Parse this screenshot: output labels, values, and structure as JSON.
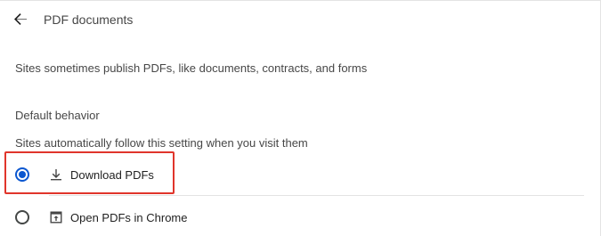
{
  "header": {
    "back_icon": "arrow-back-icon",
    "title": "PDF documents"
  },
  "description": "Sites sometimes publish PDFs, like documents, contracts, and forms",
  "default_behavior": {
    "heading": "Default behavior",
    "subtitle": "Sites automatically follow this setting when you visit them",
    "options": [
      {
        "label": "Download PDFs",
        "icon": "download-icon",
        "selected": true
      },
      {
        "label": "Open PDFs in Chrome",
        "icon": "open-in-browser-icon",
        "selected": false
      }
    ]
  },
  "colors": {
    "accent": "#0b57d0",
    "highlight_box": "#e0352b"
  }
}
